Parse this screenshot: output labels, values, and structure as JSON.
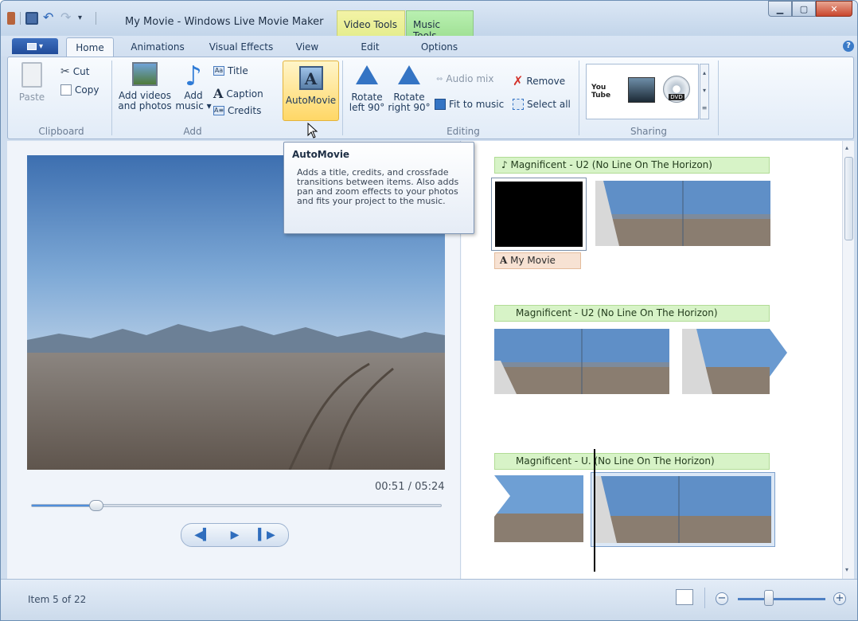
{
  "titlebar": {
    "title": "My Movie - Windows Live Movie Maker",
    "context_tabs": [
      "Video Tools",
      "Music Tools"
    ]
  },
  "tabs": {
    "home": "Home",
    "animations": "Animations",
    "visual_effects": "Visual Effects",
    "view": "View",
    "edit": "Edit",
    "options": "Options"
  },
  "ribbon": {
    "clipboard": {
      "paste": "Paste",
      "cut": "Cut",
      "copy": "Copy",
      "label": "Clipboard"
    },
    "add": {
      "add_videos_line1": "Add videos",
      "add_videos_line2": "and photos",
      "add_music_line1": "Add",
      "add_music_line2": "music ▾",
      "title": "Title",
      "caption": "Caption",
      "credits": "Credits",
      "label": "Add"
    },
    "automovie": "AutoMovie",
    "editing": {
      "rotate_left_line1": "Rotate",
      "rotate_left_line2": "left 90°",
      "rotate_right_line1": "Rotate",
      "rotate_right_line2": "right 90°",
      "audio_mix": "Audio mix",
      "remove": "Remove",
      "fit_to_music": "Fit to music",
      "select_all": "Select all",
      "label": "Editing"
    },
    "sharing": {
      "label": "Sharing",
      "youtube": "You Tube",
      "dvd": "DVD"
    }
  },
  "tooltip": {
    "title": "AutoMovie",
    "body": "Adds a title, credits, and crossfade transitions between items. Also adds pan and zoom effects to your photos and fits your project to the music."
  },
  "preview": {
    "timecode": "00:51 / 05:24",
    "progress": 0.157
  },
  "storyboard": {
    "music_labels": [
      "♪ Magnificent - U2 (No Line On The Horizon)",
      "Magnificent - U2 (No Line On The Horizon)",
      "Magnificent - U.  (No Line On The Horizon)"
    ],
    "caption": "My Movie"
  },
  "status": {
    "item_text": "Item 5 of 22",
    "zoom_level": 0.35
  },
  "colors": {
    "ribbon_highlight": "#ffd766",
    "music_bar": "#d7f3c7",
    "caption_bar": "#f7e2d3",
    "accent": "#4f8edb"
  }
}
